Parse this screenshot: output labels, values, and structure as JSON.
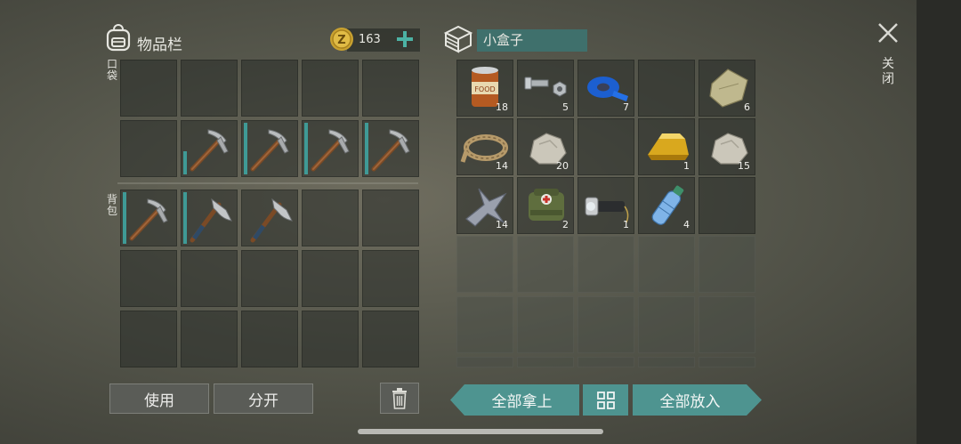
{
  "inventory": {
    "title": "物品栏",
    "coins": "163",
    "pocket_label": "口袋",
    "backpack_label": "背包",
    "pocket_rows": [
      [
        null,
        null,
        null,
        null,
        null
      ],
      [
        null,
        {
          "icon": "pickaxe-icon",
          "durability": 0.45
        },
        {
          "icon": "pickaxe-icon",
          "durability": 1.0
        },
        {
          "icon": "pickaxe-icon",
          "durability": 1.0
        },
        {
          "icon": "pickaxe-icon",
          "durability": 1.0
        }
      ]
    ],
    "backpack_rows": [
      [
        {
          "icon": "pickaxe-icon",
          "durability": 1.0
        },
        {
          "icon": "axe-icon",
          "durability": 1.0
        },
        {
          "icon": "axe-icon",
          "durability": 0.0
        },
        null,
        null
      ],
      [
        null,
        null,
        null,
        null,
        null
      ],
      [
        null,
        null,
        null,
        null,
        null
      ]
    ],
    "use_button": "使用",
    "split_button": "分开",
    "trash_icon": "trash-icon"
  },
  "container": {
    "title": "小盒子",
    "rows": [
      [
        {
          "icon": "canned-food-icon",
          "count": "18"
        },
        {
          "icon": "bolt-nut-icon",
          "count": "5"
        },
        {
          "icon": "blue-tape-icon",
          "count": "7"
        },
        null,
        {
          "icon": "cloth-icon",
          "count": "6"
        }
      ],
      [
        {
          "icon": "rope-icon",
          "count": "14"
        },
        {
          "icon": "stone-icon",
          "count": "20"
        },
        null,
        {
          "icon": "gold-bar-icon",
          "count": "1"
        },
        {
          "icon": "stone-icon",
          "count": "15"
        }
      ],
      [
        {
          "icon": "scrap-metal-icon",
          "count": "14"
        },
        {
          "icon": "first-aid-kit-icon",
          "count": "2"
        },
        {
          "icon": "flashlight-icon",
          "count": "1"
        },
        {
          "icon": "water-bottle-icon",
          "count": "4"
        },
        null
      ]
    ],
    "take_all": "全部拿上",
    "put_all": "全部放入",
    "sort_icon": "grid-sort-icon"
  },
  "close": {
    "label": "关闭",
    "icon": "close-icon"
  },
  "colors": {
    "accent": "#4e9490",
    "durability": "#3f9a96"
  }
}
